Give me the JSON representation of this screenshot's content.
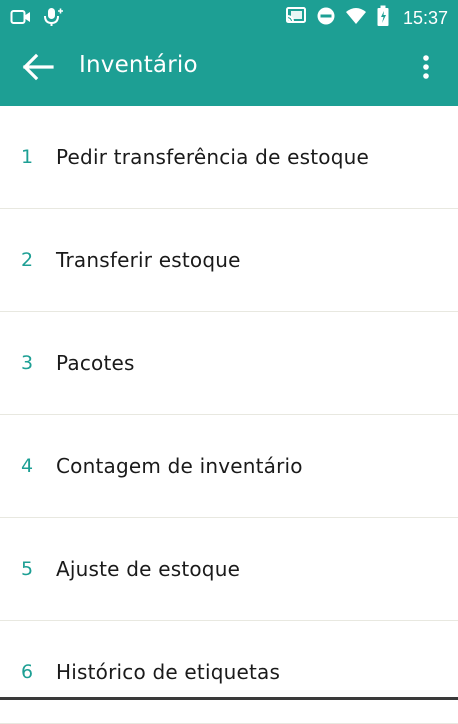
{
  "status_bar": {
    "time": "15:37",
    "icons": [
      "video-call-icon",
      "mic-icon",
      "cast-icon",
      "do-not-disturb-icon",
      "wifi-icon",
      "battery-icon"
    ]
  },
  "app_bar": {
    "title": "Inventário",
    "back_icon": "arrow-back-icon",
    "menu_icon": "more-vert-icon"
  },
  "menu": {
    "items": [
      {
        "number": "1",
        "label": "Pedir transferência de estoque"
      },
      {
        "number": "2",
        "label": "Transferir estoque"
      },
      {
        "number": "3",
        "label": "Pacotes"
      },
      {
        "number": "4",
        "label": "Contagem de inventário"
      },
      {
        "number": "5",
        "label": "Ajuste de estoque"
      },
      {
        "number": "6",
        "label": "Histórico de etiquetas"
      }
    ]
  },
  "colors": {
    "primary": "#1d9f94",
    "number": "#1d9f94",
    "text": "#1a1a1a",
    "divider": "#e8e8e0"
  }
}
